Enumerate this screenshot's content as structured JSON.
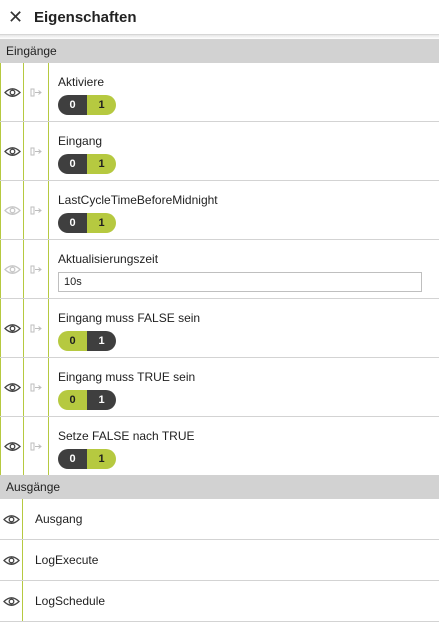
{
  "header": {
    "close_icon": "close-icon",
    "title": "Eigenschaften"
  },
  "inputs_section": {
    "title": "Eingänge"
  },
  "inputs": [
    {
      "label": "Aktiviere",
      "type": "toggle",
      "value": "1",
      "visible": true,
      "left": "0",
      "right": "1"
    },
    {
      "label": "Eingang",
      "type": "toggle",
      "value": "1",
      "visible": true,
      "left": "0",
      "right": "1"
    },
    {
      "label": "LastCycleTimeBeforeMidnight",
      "type": "toggle",
      "value": "1",
      "visible": false,
      "left": "0",
      "right": "1"
    },
    {
      "label": "Aktualisierungszeit",
      "type": "text",
      "value": "10s",
      "visible": false
    },
    {
      "label": "Eingang muss FALSE sein",
      "type": "toggle",
      "value": "0",
      "visible": true,
      "left": "0",
      "right": "1"
    },
    {
      "label": "Eingang muss TRUE sein",
      "type": "toggle",
      "value": "0",
      "visible": true,
      "left": "0",
      "right": "1"
    },
    {
      "label": "Setze FALSE nach TRUE",
      "type": "toggle",
      "value": "1",
      "visible": true,
      "left": "0",
      "right": "1"
    }
  ],
  "outputs_section": {
    "title": "Ausgänge"
  },
  "outputs": [
    {
      "label": "Ausgang"
    },
    {
      "label": "LogExecute"
    },
    {
      "label": "LogSchedule"
    }
  ],
  "colors": {
    "accent": "#b6c940",
    "toggle_off": "#3f3f3f",
    "section_bg": "#d2d2d2"
  }
}
